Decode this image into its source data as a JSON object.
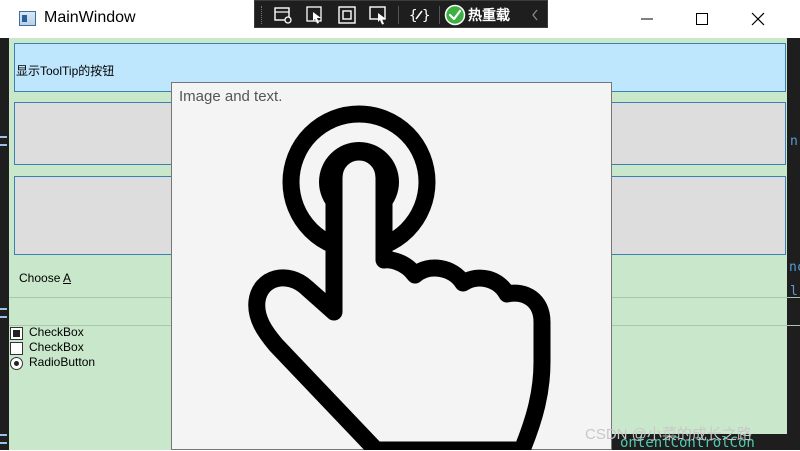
{
  "window": {
    "title": "MainWindow",
    "icons": {
      "app": "window-app-icon",
      "minimize": "minimize-icon",
      "maximize": "maximize-icon",
      "close": "close-icon"
    }
  },
  "debug_toolbar": {
    "hot_reload_label": "热重载",
    "icons": [
      "live-visual-tree-icon",
      "select-element-icon",
      "display-layout-adorners-icon",
      "track-focus-icon",
      "binding-failures-icon",
      "hot-reload-check-icon",
      "collapse-chevron-icon"
    ]
  },
  "content": {
    "tooltip_button_label": "显示ToolTip的按钮",
    "choose_label_prefix": "Choose ",
    "choose_label_access_key": "A",
    "checkbox1_label": "CheckBox",
    "checkbox1_checked": true,
    "checkbox2_label": "CheckBox",
    "checkbox2_checked": false,
    "radio_label": "RadioButton",
    "radio_checked": true
  },
  "tooltip": {
    "text": "Image and text.",
    "image_icon": "hand-pointer-tap-icon"
  },
  "background": {
    "code_bottom": "ontentControlCon",
    "code_frag_1": "n",
    "code_frag_2": "nc",
    "code_frag_3": "l"
  },
  "watermark": "CSDN @小菜的成长之路",
  "colors": {
    "client_background": "#c9e8cb",
    "tooltip_button_background": "#bee6fd",
    "button_background": "#dddddd",
    "button_border": "#3c7fb1",
    "debug_toolbar_background": "#1e1e1e",
    "hot_reload_check": "#3cb043"
  }
}
